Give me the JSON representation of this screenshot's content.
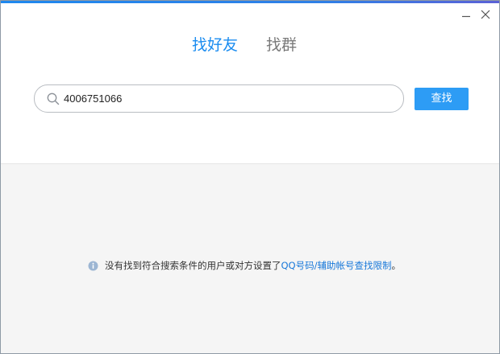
{
  "colors": {
    "primary": "#2d9cf5",
    "link": "#1677d9",
    "tab_active": "#1a8cf0",
    "tab_inactive": "#7a7a7a"
  },
  "window": {
    "min_icon": "minimize-icon",
    "close_icon": "close-icon"
  },
  "tabs": [
    {
      "label": "找好友",
      "active": true
    },
    {
      "label": "找群",
      "active": false
    }
  ],
  "search": {
    "icon": "search-icon",
    "value": "4006751066",
    "button_label": "查找"
  },
  "results": {
    "info_icon": "info-icon",
    "message_prefix": "没有找到符合搜索条件的用户或对方设置了",
    "message_link": "QQ号码/辅助帐号查找限制",
    "message_suffix": "。"
  }
}
